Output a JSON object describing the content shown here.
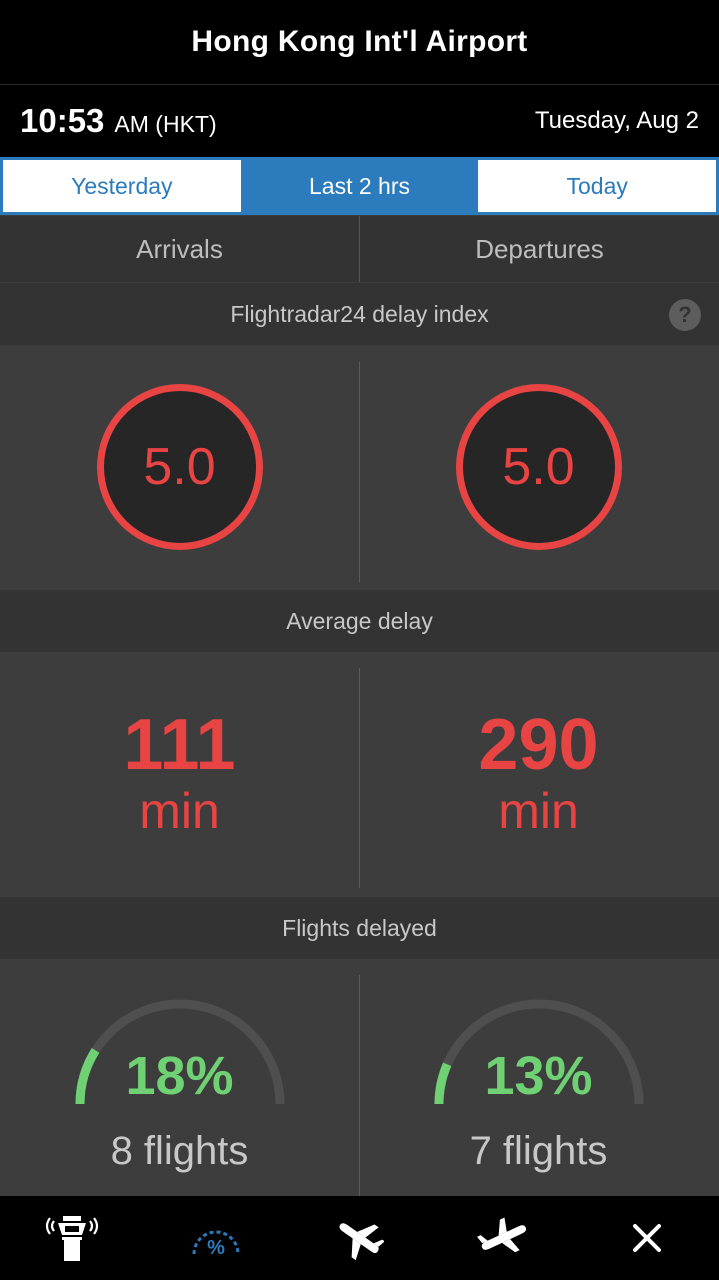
{
  "header": {
    "title": "Hong Kong Int'l Airport"
  },
  "clock": {
    "time": "10:53",
    "ampm_tz": "AM (HKT)",
    "date": "Tuesday, Aug 2"
  },
  "range_selector": {
    "options": [
      "Yesterday",
      "Last 2 hrs",
      "Today"
    ],
    "selected": "Last 2 hrs"
  },
  "tabs": [
    "Arrivals",
    "Departures"
  ],
  "delay_index": {
    "heading": "Flightradar24 delay index",
    "help": "?",
    "arrivals": "5.0",
    "departures": "5.0"
  },
  "average_delay": {
    "heading": "Average delay",
    "arrivals": {
      "value": "111",
      "unit": "min"
    },
    "departures": {
      "value": "290",
      "unit": "min"
    }
  },
  "flights_delayed": {
    "heading": "Flights delayed",
    "arrivals": {
      "percent_text": "18%",
      "percent": 18,
      "flights": "8 flights"
    },
    "departures": {
      "percent_text": "13%",
      "percent": 13,
      "flights": "7 flights"
    }
  },
  "bottom_nav": [
    "control-tower-icon",
    "percent-gauge-icon",
    "arrival-plane-icon",
    "departure-plane-icon",
    "close-icon"
  ],
  "colors": {
    "accent": "#2b7bbd",
    "delay_red": "#e84444",
    "ok_green": "#6fd173"
  }
}
